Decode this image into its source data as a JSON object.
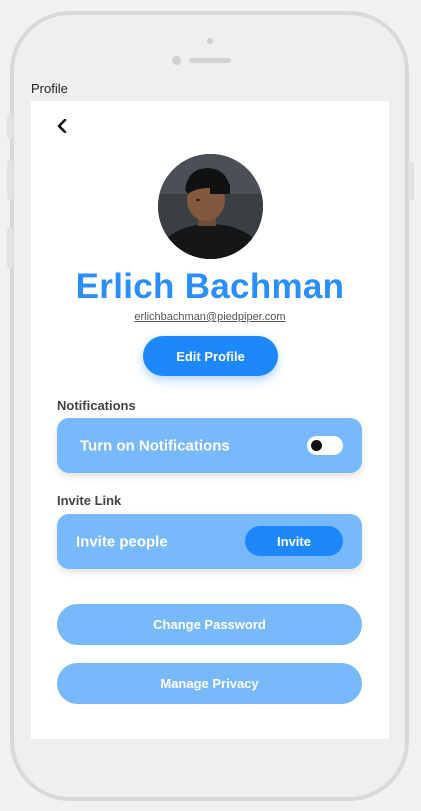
{
  "caption": "Profile",
  "profile": {
    "name": "Erlich Bachman",
    "email": "erlichbachman@piedpiper.com",
    "edit_label": "Edit Profile"
  },
  "notifications": {
    "section_label": "Notifications",
    "toggle_label": "Turn on Notifications",
    "enabled": false
  },
  "invite": {
    "section_label": "Invite Link",
    "label": "Invite people",
    "button_label": "Invite"
  },
  "actions": {
    "change_password": "Change Password",
    "manage_privacy": "Manage Privacy"
  },
  "icons": {
    "back": "chevron-left-icon"
  },
  "colors": {
    "accent": "#1d88fb",
    "name": "#2a8ffb",
    "card": "#78b9fc"
  }
}
